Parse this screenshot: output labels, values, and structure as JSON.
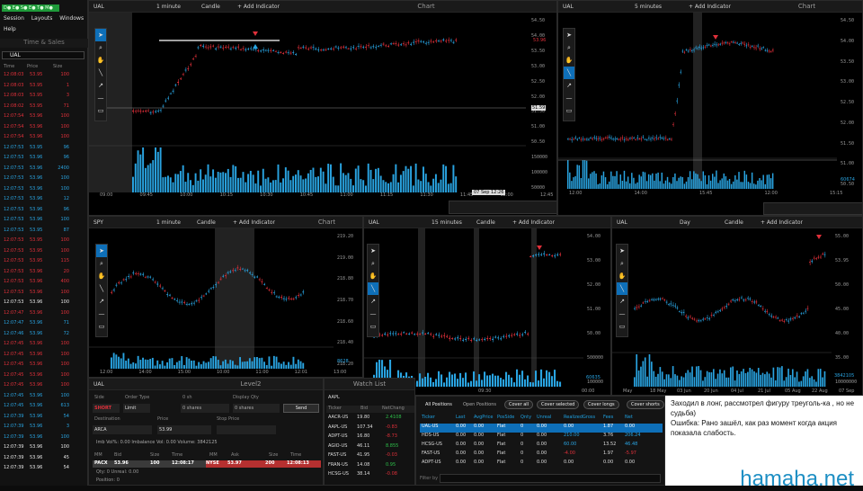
{
  "menu": {
    "items": [
      "Session",
      "Layouts",
      "Windows",
      "Help"
    ]
  },
  "tns": {
    "title": "Time & Sales",
    "symbol": "UAL",
    "col_time": "Time",
    "col_price": "Price",
    "col_size": "Size",
    "rows": [
      [
        "12:08:03",
        "53.95",
        "100",
        "r"
      ],
      [
        "12:08:03",
        "53.95",
        "1",
        "r"
      ],
      [
        "12:08:03",
        "53.95",
        "3",
        "r"
      ],
      [
        "12:08:02",
        "53.95",
        "71",
        "r"
      ],
      [
        "12:07:54",
        "53.96",
        "100",
        "r"
      ],
      [
        "12:07:54",
        "53.96",
        "100",
        "r"
      ],
      [
        "12:07:54",
        "53.96",
        "100",
        "r"
      ],
      [
        "12:07:53",
        "53.95",
        "96",
        "c"
      ],
      [
        "12:07:53",
        "53.96",
        "96",
        "c"
      ],
      [
        "12:07:53",
        "53.96",
        "2400",
        "c"
      ],
      [
        "12:07:53",
        "53.96",
        "100",
        "c"
      ],
      [
        "12:07:53",
        "53.96",
        "100",
        "c"
      ],
      [
        "12:07:53",
        "53.96",
        "12",
        "c"
      ],
      [
        "12:07:53",
        "53.96",
        "96",
        "c"
      ],
      [
        "12:07:53",
        "53.96",
        "100",
        "c"
      ],
      [
        "12:07:53",
        "53.95",
        "87",
        "c"
      ],
      [
        "12:07:53",
        "53.95",
        "100",
        "r"
      ],
      [
        "12:07:53",
        "53.95",
        "100",
        "r"
      ],
      [
        "12:07:53",
        "53.95",
        "115",
        "r"
      ],
      [
        "12:07:53",
        "53.96",
        "20",
        "r"
      ],
      [
        "12:07:53",
        "53.96",
        "400",
        "r"
      ],
      [
        "12:07:53",
        "53.96",
        "100",
        "r"
      ],
      [
        "12:07:53",
        "53.96",
        "100",
        "w"
      ],
      [
        "12:07:47",
        "53.96",
        "100",
        "r"
      ],
      [
        "12:07:47",
        "53.96",
        "71",
        "c"
      ],
      [
        "12:07:46",
        "53.96",
        "72",
        "c"
      ],
      [
        "12:07:45",
        "53.96",
        "100",
        "r"
      ],
      [
        "12:07:45",
        "53.96",
        "100",
        "r"
      ],
      [
        "12:07:45",
        "53.96",
        "100",
        "r"
      ],
      [
        "12:07:45",
        "53.96",
        "100",
        "r"
      ],
      [
        "12:07:45",
        "53.96",
        "100",
        "r"
      ],
      [
        "12:07:45",
        "53.96",
        "100",
        "c"
      ],
      [
        "12:07:45",
        "53.96",
        "613",
        "c"
      ],
      [
        "12:07:39",
        "53.96",
        "54",
        "c"
      ],
      [
        "12:07:39",
        "53.96",
        "3",
        "c"
      ],
      [
        "12:07:39",
        "53.96",
        "100",
        "c"
      ],
      [
        "12:07:39",
        "53.96",
        "100",
        "w"
      ],
      [
        "12:07:39",
        "53.96",
        "45",
        "w"
      ],
      [
        "12:07:39",
        "53.96",
        "54",
        "w"
      ]
    ]
  },
  "charts": {
    "c1": {
      "symbol": "UAL",
      "interval": "1 minute",
      "type": "Candle",
      "add": "+ Add Indicator",
      "title": "Chart",
      "y_ticks": [
        "54.50",
        "54.00",
        "53.50",
        "53.00",
        "52.50",
        "52.00",
        "51.50",
        "51.00",
        "50.50",
        "150000",
        "100000",
        "50000"
      ],
      "price_tag": "53.96",
      "cursor_tag": "51.59",
      "x_ticks": [
        "09:00",
        "09:45",
        "10:00",
        "10:15",
        "10:30",
        "10:45",
        "11:00",
        "11:15",
        "11:30",
        "11:45",
        "12:00",
        "12:45"
      ],
      "date_tag": "07 Sep 12:26"
    },
    "c2": {
      "symbol": "UAL",
      "interval": "5 minutes",
      "add": "+ Add Indicator",
      "title": "Chart",
      "y_ticks": [
        "54.50",
        "54.00",
        "53.50",
        "53.00",
        "52.50",
        "52.00",
        "51.50",
        "51.00",
        "50.50"
      ],
      "vol_tag": "60674",
      "x_ticks": [
        "12:00",
        "14:00",
        "15:45",
        "12:00",
        "15:15"
      ]
    },
    "c3": {
      "symbol": "SPY",
      "interval": "1 minute",
      "type": "Candle",
      "add": "+ Add Indicator",
      "title": "Chart",
      "y_ticks": [
        "219.20",
        "219.00",
        "218.80",
        "218.70",
        "218.60",
        "218.40",
        "218.20"
      ],
      "vol_tag": "8628",
      "x_ticks": [
        "12:00",
        "14:00",
        "15:00",
        "10:00",
        "11:00",
        "12:01",
        "13:00"
      ]
    },
    "c4": {
      "symbol": "UAL",
      "interval": "15 minutes",
      "type": "Candle",
      "add": "+ Add Indicator",
      "y_ticks": [
        "54.00",
        "53.00",
        "52.00",
        "51.00",
        "50.00",
        "500000",
        "100000"
      ],
      "vol_tag": "60635",
      "x_ticks": [
        "00:00",
        "09:30",
        "00:00"
      ]
    },
    "c5": {
      "symbol": "UAL",
      "interval": "Day",
      "type": "Candle",
      "add": "+ Add Indicator",
      "y_ticks": [
        "55.00",
        "53.95",
        "50.00",
        "45.00",
        "40.00",
        "35.00",
        "10000000"
      ],
      "vol_tag": "3842105",
      "x_ticks": [
        "May",
        "18 May",
        "03 Jun",
        "20 Jun",
        "04 Jul",
        "21 Jul",
        "05 Aug",
        "22 Aug",
        "07 Sep"
      ]
    }
  },
  "level2": {
    "symbol": "UAL",
    "title": "Level2",
    "side_label": "Side",
    "ordertype_label": "Order Type",
    "qty_label": "0 sh",
    "display_label": "Display Qty",
    "side": "SHORT",
    "order_type": "Limit",
    "qty": "0 shares",
    "display_qty": "0 shares",
    "send": "Send",
    "dest_label": "Destination",
    "dest": "ARCA",
    "price_label": "Price",
    "price": "53.99",
    "stop_label": "Stop Price",
    "stats": "Imb Vol%: 0.00   Imbalance Vol: 0.00   Volume: 3842125",
    "cols": [
      "MM",
      "Bid",
      "Size",
      "Time",
      "MM",
      "Ask",
      "Size",
      "Time"
    ],
    "bid": [
      "PACX",
      "53.96",
      "100",
      "12:08:17"
    ],
    "ask": [
      "NYSE",
      "53.97",
      "200",
      "12:08:13"
    ],
    "qty_bottom": "Qty: 0   Unreal: 0.00",
    "position": "Position: 0"
  },
  "watch": {
    "title": "Watch List",
    "symbol": "AAPL",
    "cols": [
      "Ticker",
      "Bid",
      "NetChang"
    ],
    "rows": [
      [
        "AACR-US",
        "19.80",
        "2.4108",
        "g"
      ],
      [
        "AAPL-US",
        "107.34",
        "-0.83",
        "r"
      ],
      [
        "ADPT-US",
        "16.80",
        "-8.73",
        "r"
      ],
      [
        "AGIO-US",
        "46.11",
        "8.855",
        "g"
      ],
      [
        "FAST-US",
        "41.95",
        "-0.03",
        "r"
      ],
      [
        "FRAN-US",
        "14.08",
        "0.95",
        "g"
      ],
      [
        "HCSG-US",
        "38.14",
        "-0.08",
        "r"
      ]
    ]
  },
  "positions": {
    "tab_all": "All Positions",
    "tab_open": "Open Positions",
    "buttons": [
      "Cover all",
      "Cover selected",
      "Cover longs",
      "Cover shorts"
    ],
    "cols": [
      "Ticker",
      "Last",
      "AvgPrice",
      "PosSide",
      "Qnty",
      "Unreal",
      "RealizedGross",
      "Fees",
      "Net"
    ],
    "rows": [
      [
        "UAL-US",
        "0.00",
        "0.00",
        "Flat",
        "0",
        "0.00",
        "0.00",
        "1.87",
        "0.00"
      ],
      [
        "HDS-US",
        "0.00",
        "0.00",
        "Flat",
        "0",
        "0.00",
        "210.00",
        "3.76",
        "206.24"
      ],
      [
        "HCSG-US",
        "0.00",
        "0.00",
        "Flat",
        "0",
        "0.00",
        "60.00",
        "13.52",
        "46.48"
      ],
      [
        "FAST-US",
        "0.00",
        "0.00",
        "Flat",
        "0",
        "0.00",
        "-4.00",
        "1.97",
        "-5.97"
      ],
      [
        "ADPT-US",
        "0.00",
        "0.00",
        "Flat",
        "0",
        "0.00",
        "0.00",
        "0.00",
        "0.00"
      ]
    ],
    "filter": "Filter by"
  },
  "note": {
    "line1": "Заходил в лонг, рассмотрел фигуру треуголь-ка , но не судьба)",
    "line2": "Ошибка: Рано зашёл, как раз момент когда акция показала слабость."
  },
  "brand": "hamaha.net",
  "colors": {
    "up": "#29a3e0",
    "down": "#e0303a",
    "bg": "#000000",
    "accent": "#0e6fb8"
  }
}
